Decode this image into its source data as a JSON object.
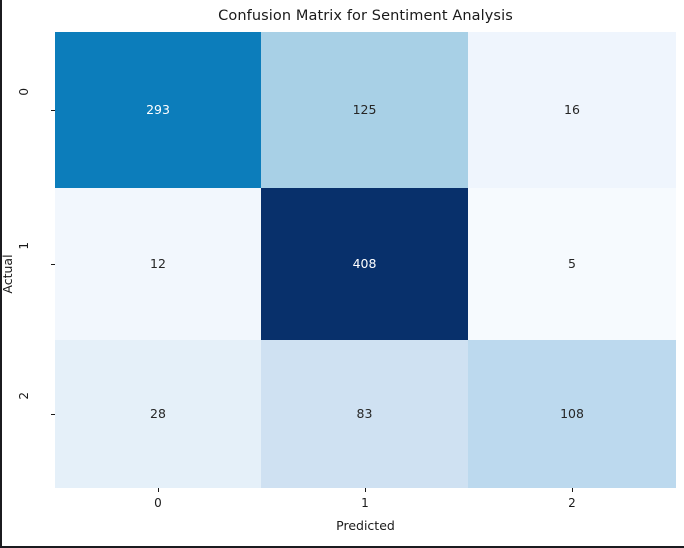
{
  "chart_data": {
    "type": "heatmap",
    "title": "Confusion Matrix for Sentiment Analysis",
    "xlabel": "Predicted",
    "ylabel": "Actual",
    "x_tick_labels": [
      "0",
      "1",
      "2"
    ],
    "y_tick_labels": [
      "0",
      "1",
      "2"
    ],
    "grid": false,
    "legend": "none",
    "colormap": "Blues",
    "value_range": [
      5,
      408
    ],
    "rows": [
      {
        "actual": "0",
        "cells": [
          {
            "predicted": "0",
            "value": "293",
            "color": "#0c7dbb",
            "text_color": "#ffffff"
          },
          {
            "predicted": "1",
            "value": "125",
            "color": "#a8d0e6",
            "text_color": "#262626"
          },
          {
            "predicted": "2",
            "value": "16",
            "color": "#eff5fd",
            "text_color": "#262626"
          }
        ]
      },
      {
        "actual": "1",
        "cells": [
          {
            "predicted": "0",
            "value": "12",
            "color": "#f2f7fd",
            "text_color": "#262626"
          },
          {
            "predicted": "1",
            "value": "408",
            "color": "#08306b",
            "text_color": "#ffffff"
          },
          {
            "predicted": "2",
            "value": "5",
            "color": "#f6fafe",
            "text_color": "#262626"
          }
        ]
      },
      {
        "actual": "2",
        "cells": [
          {
            "predicted": "0",
            "value": "28",
            "color": "#e5f0f9",
            "text_color": "#262626"
          },
          {
            "predicted": "1",
            "value": "83",
            "color": "#cfe1f2",
            "text_color": "#262626"
          },
          {
            "predicted": "2",
            "value": "108",
            "color": "#bcd9ee",
            "text_color": "#262626"
          }
        ]
      }
    ]
  }
}
